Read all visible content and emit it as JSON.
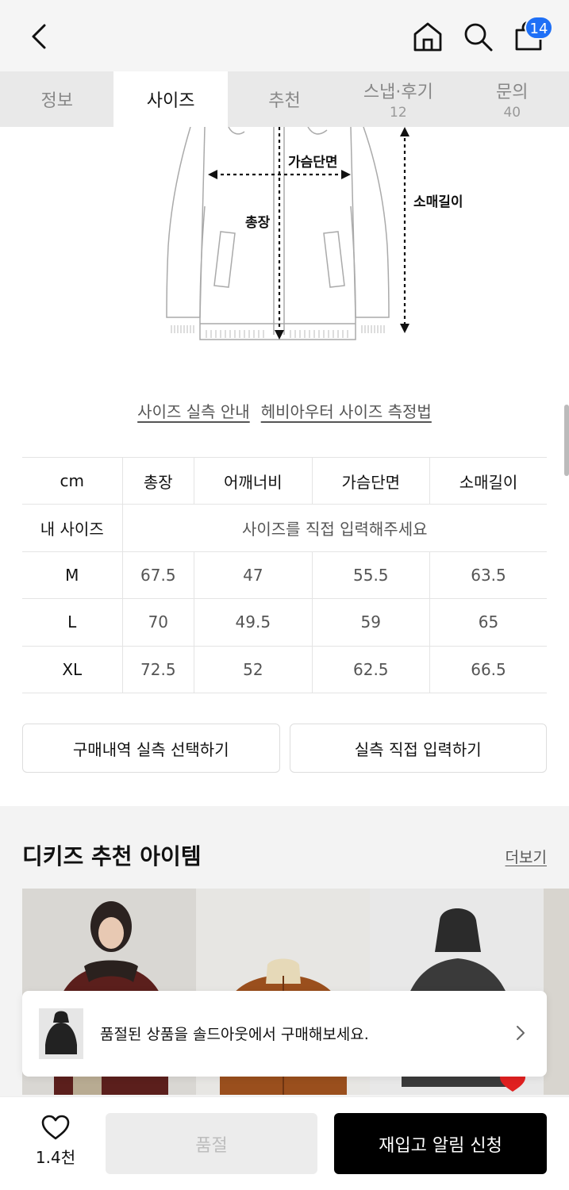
{
  "header": {
    "cart_count": "14",
    "icons": [
      "chevron-left-icon",
      "home-icon",
      "search-icon",
      "shopping-bag-icon"
    ]
  },
  "tabs": [
    {
      "label": "정보",
      "count": ""
    },
    {
      "label": "사이즈",
      "count": "",
      "active": true
    },
    {
      "label": "추천",
      "count": ""
    },
    {
      "label": "스냅·후기",
      "count": "12"
    },
    {
      "label": "문의",
      "count": "40"
    }
  ],
  "diagram": {
    "chest_label": "가슴단면",
    "length_label": "총장",
    "sleeve_label": "소매길이"
  },
  "guide_links": [
    "사이즈 실측 안내",
    "헤비아우터 사이즈 측정법"
  ],
  "size_table": {
    "headers": [
      "cm",
      "총장",
      "어깨너비",
      "가슴단면",
      "소매길이"
    ],
    "my_size_label": "내 사이즈",
    "my_size_placeholder": "사이즈를 직접 입력해주세요",
    "rows": [
      [
        "M",
        "67.5",
        "47",
        "55.5",
        "63.5"
      ],
      [
        "L",
        "70",
        "49.5",
        "59",
        "65"
      ],
      [
        "XL",
        "72.5",
        "52",
        "62.5",
        "66.5"
      ]
    ]
  },
  "buttons": {
    "select_purchase": "구매내역 실측 선택하기",
    "direct_input": "실측 직접 입력하기"
  },
  "recommend": {
    "title": "디키즈 추천 아이템",
    "more": "더보기"
  },
  "toast": {
    "text": "품절된 상품을 솔드아웃에서 구매해보세요."
  },
  "bottom_bar": {
    "like_count": "1.4천",
    "soldout_label": "품절",
    "notify_label": "재입고 알림 신청"
  },
  "colors": {
    "badge": "#1e6ff6",
    "primary_button": "#000000",
    "disabled_button": "#ececec",
    "heart_red": "#e02020"
  }
}
